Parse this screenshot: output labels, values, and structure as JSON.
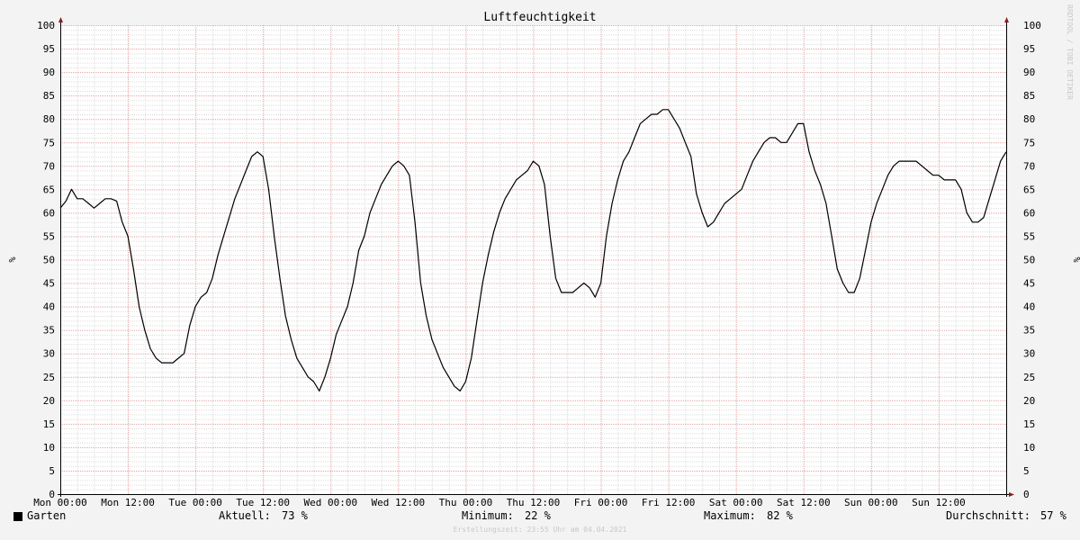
{
  "chart_data": {
    "type": "line",
    "title": "Luftfeuchtigkeit",
    "ylabel": "%",
    "ylim": [
      0,
      100
    ],
    "y_ticks": [
      0,
      5,
      10,
      15,
      20,
      25,
      30,
      35,
      40,
      45,
      50,
      55,
      60,
      65,
      70,
      75,
      80,
      85,
      90,
      95,
      100
    ],
    "x_tick_labels": [
      "Mon 00:00",
      "Mon 12:00",
      "Tue 00:00",
      "Tue 12:00",
      "Wed 00:00",
      "Wed 12:00",
      "Thu 00:00",
      "Thu 12:00",
      "Fri 00:00",
      "Fri 12:00",
      "Sat 00:00",
      "Sat 12:00",
      "Sun 00:00",
      "Sun 12:00"
    ],
    "x_range_hours": [
      0,
      168
    ],
    "grid": true,
    "series": [
      {
        "name": "Garten",
        "color": "#000000",
        "points": [
          [
            0,
            61
          ],
          [
            1,
            62.5
          ],
          [
            2,
            65
          ],
          [
            3,
            63
          ],
          [
            4,
            63
          ],
          [
            5,
            62
          ],
          [
            6,
            61
          ],
          [
            7,
            62
          ],
          [
            8,
            63
          ],
          [
            9,
            63
          ],
          [
            10,
            62.5
          ],
          [
            11,
            58
          ],
          [
            12,
            55
          ],
          [
            13,
            48
          ],
          [
            14,
            40
          ],
          [
            15,
            35
          ],
          [
            16,
            31
          ],
          [
            17,
            29
          ],
          [
            18,
            28
          ],
          [
            19,
            28
          ],
          [
            20,
            28
          ],
          [
            21,
            29
          ],
          [
            22,
            30
          ],
          [
            23,
            36
          ],
          [
            24,
            40
          ],
          [
            25,
            42
          ],
          [
            26,
            43
          ],
          [
            27,
            46
          ],
          [
            28,
            51
          ],
          [
            29,
            55
          ],
          [
            30,
            59
          ],
          [
            31,
            63
          ],
          [
            32,
            66
          ],
          [
            33,
            69
          ],
          [
            34,
            72
          ],
          [
            35,
            73
          ],
          [
            36,
            72
          ],
          [
            37,
            65
          ],
          [
            38,
            55
          ],
          [
            39,
            46
          ],
          [
            40,
            38
          ],
          [
            41,
            33
          ],
          [
            42,
            29
          ],
          [
            43,
            27
          ],
          [
            44,
            25
          ],
          [
            45,
            24
          ],
          [
            46,
            22
          ],
          [
            47,
            25
          ],
          [
            48,
            29
          ],
          [
            49,
            34
          ],
          [
            50,
            37
          ],
          [
            51,
            40
          ],
          [
            52,
            45
          ],
          [
            53,
            52
          ],
          [
            54,
            55
          ],
          [
            55,
            60
          ],
          [
            56,
            63
          ],
          [
            57,
            66
          ],
          [
            58,
            68
          ],
          [
            59,
            70
          ],
          [
            60,
            71
          ],
          [
            61,
            70
          ],
          [
            62,
            68
          ],
          [
            63,
            58
          ],
          [
            64,
            45
          ],
          [
            65,
            38
          ],
          [
            66,
            33
          ],
          [
            67,
            30
          ],
          [
            68,
            27
          ],
          [
            69,
            25
          ],
          [
            70,
            23
          ],
          [
            71,
            22
          ],
          [
            72,
            24
          ],
          [
            73,
            29
          ],
          [
            74,
            37
          ],
          [
            75,
            45
          ],
          [
            76,
            51
          ],
          [
            77,
            56
          ],
          [
            78,
            60
          ],
          [
            79,
            63
          ],
          [
            80,
            65
          ],
          [
            81,
            67
          ],
          [
            82,
            68
          ],
          [
            83,
            69
          ],
          [
            84,
            71
          ],
          [
            85,
            70
          ],
          [
            86,
            66
          ],
          [
            87,
            55
          ],
          [
            88,
            46
          ],
          [
            89,
            43
          ],
          [
            90,
            43
          ],
          [
            91,
            43
          ],
          [
            92,
            44
          ],
          [
            93,
            45
          ],
          [
            94,
            44
          ],
          [
            95,
            42
          ],
          [
            96,
            45
          ],
          [
            97,
            55
          ],
          [
            98,
            62
          ],
          [
            99,
            67
          ],
          [
            100,
            71
          ],
          [
            101,
            73
          ],
          [
            102,
            76
          ],
          [
            103,
            79
          ],
          [
            104,
            80
          ],
          [
            105,
            81
          ],
          [
            106,
            81
          ],
          [
            107,
            82
          ],
          [
            108,
            82
          ],
          [
            109,
            80
          ],
          [
            110,
            78
          ],
          [
            111,
            75
          ],
          [
            112,
            72
          ],
          [
            113,
            64
          ],
          [
            114,
            60
          ],
          [
            115,
            57
          ],
          [
            116,
            58
          ],
          [
            117,
            60
          ],
          [
            118,
            62
          ],
          [
            119,
            63
          ],
          [
            120,
            64
          ],
          [
            121,
            65
          ],
          [
            122,
            68
          ],
          [
            123,
            71
          ],
          [
            124,
            73
          ],
          [
            125,
            75
          ],
          [
            126,
            76
          ],
          [
            127,
            76
          ],
          [
            128,
            75
          ],
          [
            129,
            75
          ],
          [
            130,
            77
          ],
          [
            131,
            79
          ],
          [
            132,
            79
          ],
          [
            133,
            73
          ],
          [
            134,
            69
          ],
          [
            135,
            66
          ],
          [
            136,
            62
          ],
          [
            137,
            55
          ],
          [
            138,
            48
          ],
          [
            139,
            45
          ],
          [
            140,
            43
          ],
          [
            141,
            43
          ],
          [
            142,
            46
          ],
          [
            143,
            52
          ],
          [
            144,
            58
          ],
          [
            145,
            62
          ],
          [
            146,
            65
          ],
          [
            147,
            68
          ],
          [
            148,
            70
          ],
          [
            149,
            71
          ],
          [
            150,
            71
          ],
          [
            151,
            71
          ],
          [
            152,
            71
          ],
          [
            153,
            70
          ],
          [
            154,
            69
          ],
          [
            155,
            68
          ],
          [
            156,
            68
          ],
          [
            157,
            67
          ],
          [
            158,
            67
          ],
          [
            159,
            67
          ],
          [
            160,
            65
          ],
          [
            161,
            60
          ],
          [
            162,
            58
          ],
          [
            163,
            58
          ],
          [
            164,
            59
          ],
          [
            165,
            63
          ],
          [
            166,
            67
          ],
          [
            167,
            71
          ],
          [
            168,
            73
          ]
        ]
      }
    ],
    "stats": {
      "legend_label": "Garten",
      "aktuell_label": "Aktuell:",
      "aktuell_value": "73 %",
      "minimum_label": "Minimum:",
      "minimum_value": "22 %",
      "maximum_label": "Maximum:",
      "maximum_value": "82 %",
      "durchschnitt_label": "Durchschnitt:",
      "durchschnitt_value": "57 %"
    },
    "footer": "Erstellungszeit: 23:55 Uhr am 04.04.2021",
    "watermark": "RRDTOOL / TOBI OETIKER"
  }
}
